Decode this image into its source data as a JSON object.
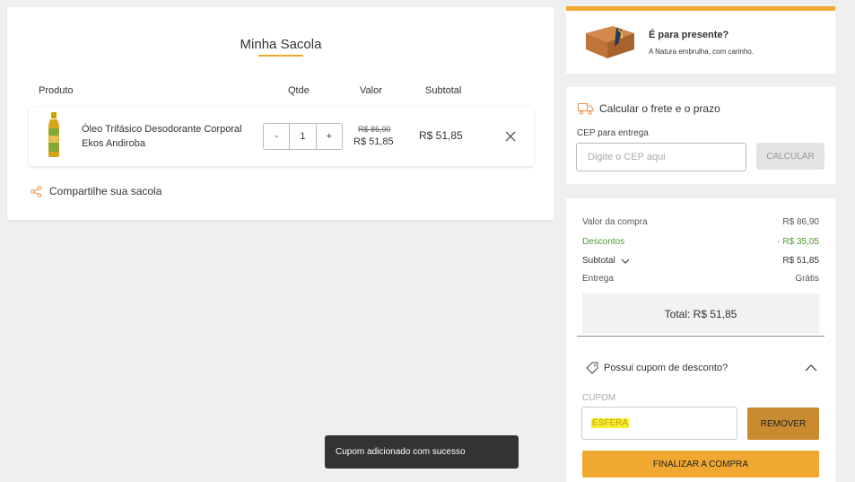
{
  "bag": {
    "title": "Minha Sacola",
    "columns": {
      "product": "Produto",
      "qty": "Qtde",
      "price": "Valor",
      "subtotal": "Subtotal"
    },
    "items": [
      {
        "name": "Óleo Trifásico Desodorante Corporal Ekos Andiroba",
        "qty_minus": "-",
        "qty": "1",
        "qty_plus": "+",
        "old_price": "R$ 86,90",
        "price": "R$ 51,85",
        "subtotal": "R$ 51,85",
        "remove_icon": "close-icon"
      }
    ],
    "share_label": "Compartilhe sua sacola"
  },
  "gift": {
    "title": "É para presente?",
    "subtitle": "A Natura embrulha, com carinho."
  },
  "freight": {
    "title": "Calcular o frete e o prazo",
    "cep_label": "CEP para entrega",
    "cep_placeholder": "Digite o CEP aqui",
    "calc_button": "CALCULAR"
  },
  "summary": {
    "purchase_label": "Valor da compra",
    "purchase_value": "R$ 86,90",
    "discount_label": "Descontos",
    "discount_value": "- R$ 35,05",
    "subtotal_label": "Subtotal",
    "subtotal_value": "R$ 51,85",
    "delivery_label": "Entrega",
    "delivery_value": "Grátis",
    "total": "Total: R$ 51,85"
  },
  "coupon": {
    "question": "Possui cupom de desconto?",
    "label": "CUPOM",
    "value": "ESFERA",
    "remove_button": "REMOVER"
  },
  "checkout_button": "FINALIZAR A COMPRA",
  "toast": "Cupom adicionado com sucesso",
  "colors": {
    "accent": "#f0a830",
    "remove_button": "#c98b2f",
    "discount": "#4a9a2f",
    "toast_bg": "#333333"
  }
}
